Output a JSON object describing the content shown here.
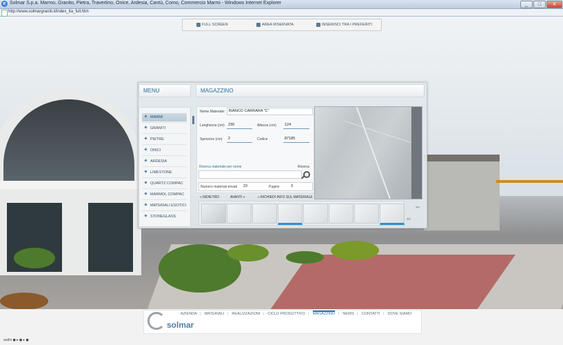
{
  "browser": {
    "title": "Solmar S.p.a. Marmo, Granito, Pietra, Travertino, Onice, Ardesia, Cantù, Como, Commercio Marmi - Windows Internet Explorer",
    "url": "http://www.solmargraniti.it/index_ita_full.htm",
    "min": "_",
    "max": "□",
    "close": "X"
  },
  "toolbar": {
    "fullscreen": "FULL SCREEN",
    "reserved": "AREA RISERVATA",
    "favorites": "INSERISCI TRA I PREFERITI"
  },
  "menu": {
    "title": "MENU",
    "items": [
      "MARMI",
      "GRANITI",
      "PIETRE",
      "ONICI",
      "ARDESIA",
      "LIMESTONE",
      "QUARTZ COMPAC",
      "MARMOL COMPAC",
      "MATERIALI ESOTICI",
      "STONEGLASS"
    ]
  },
  "magazzino": {
    "title": "MAGAZZINO",
    "material_label": "Nome Materiale:",
    "material_value": "BIANCO CARRARA \"C\"",
    "length_label": "Lunghezza (cm)",
    "length_value": "230",
    "height_label": "Altezza (cm)",
    "height_value": "124",
    "thickness_label": "Spessore (cm)",
    "thickness_value": "2",
    "code_label": "Codice",
    "code_value": "87185",
    "search_label": "Ricerca materiale per nome",
    "search_button": "Ricerca",
    "found_label": "Numero materiali trovati",
    "found_value": "23",
    "pages_label": "Pagine",
    "pages_value": "3",
    "back": "INDIETRO",
    "forward": "AVANTI",
    "request": "RICHIEDI INFO SUL MATERIALE",
    "next_page": ">>",
    "prev_page": "<<"
  },
  "footer": {
    "brand": "solmar",
    "nav": [
      "AZIENDA",
      "MATERIALI",
      "REALIZZAZIONI",
      "CICLO PRODUTTIVO",
      "MAGAZZINO",
      "NEWS",
      "CONTATTI",
      "DOVE SIAMO"
    ],
    "audio": "audio ◼ ▸ ◼ ▸ ◼"
  }
}
